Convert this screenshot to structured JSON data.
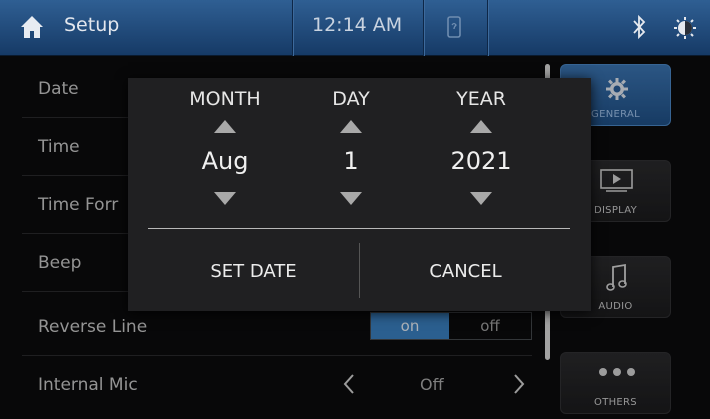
{
  "topbar": {
    "title": "Setup",
    "time": "12:14 AM",
    "icons": [
      "home-icon",
      "phone-icon",
      "bluetooth-icon",
      "brightness-icon"
    ]
  },
  "settings": {
    "rows": [
      {
        "label": "Date"
      },
      {
        "label": "Time"
      },
      {
        "label": "Time Forr"
      },
      {
        "label": "Beep"
      },
      {
        "label": "Reverse Line",
        "toggle_on": "on",
        "toggle_off": "off"
      },
      {
        "label": "Internal Mic",
        "value": "Off"
      }
    ]
  },
  "tabs": [
    {
      "label": "GENERAL",
      "icon": "gear-icon",
      "active": true
    },
    {
      "label": "DISPLAY",
      "icon": "display-icon",
      "active": false
    },
    {
      "label": "AUDIO",
      "icon": "music-note-icon",
      "active": false
    },
    {
      "label": "OTHERS",
      "icon": "more-dots-icon",
      "active": false
    }
  ],
  "dialog": {
    "columns": [
      {
        "header": "MONTH",
        "value": "Aug"
      },
      {
        "header": "DAY",
        "value": "1"
      },
      {
        "header": "YEAR",
        "value": "2021"
      }
    ],
    "set_label": "SET DATE",
    "cancel_label": "CANCEL"
  },
  "colors": {
    "topbar": "#2f5f93",
    "accent": "#3a7fbf",
    "dialog_bg": "#202022",
    "background": "#0b0b0c"
  }
}
